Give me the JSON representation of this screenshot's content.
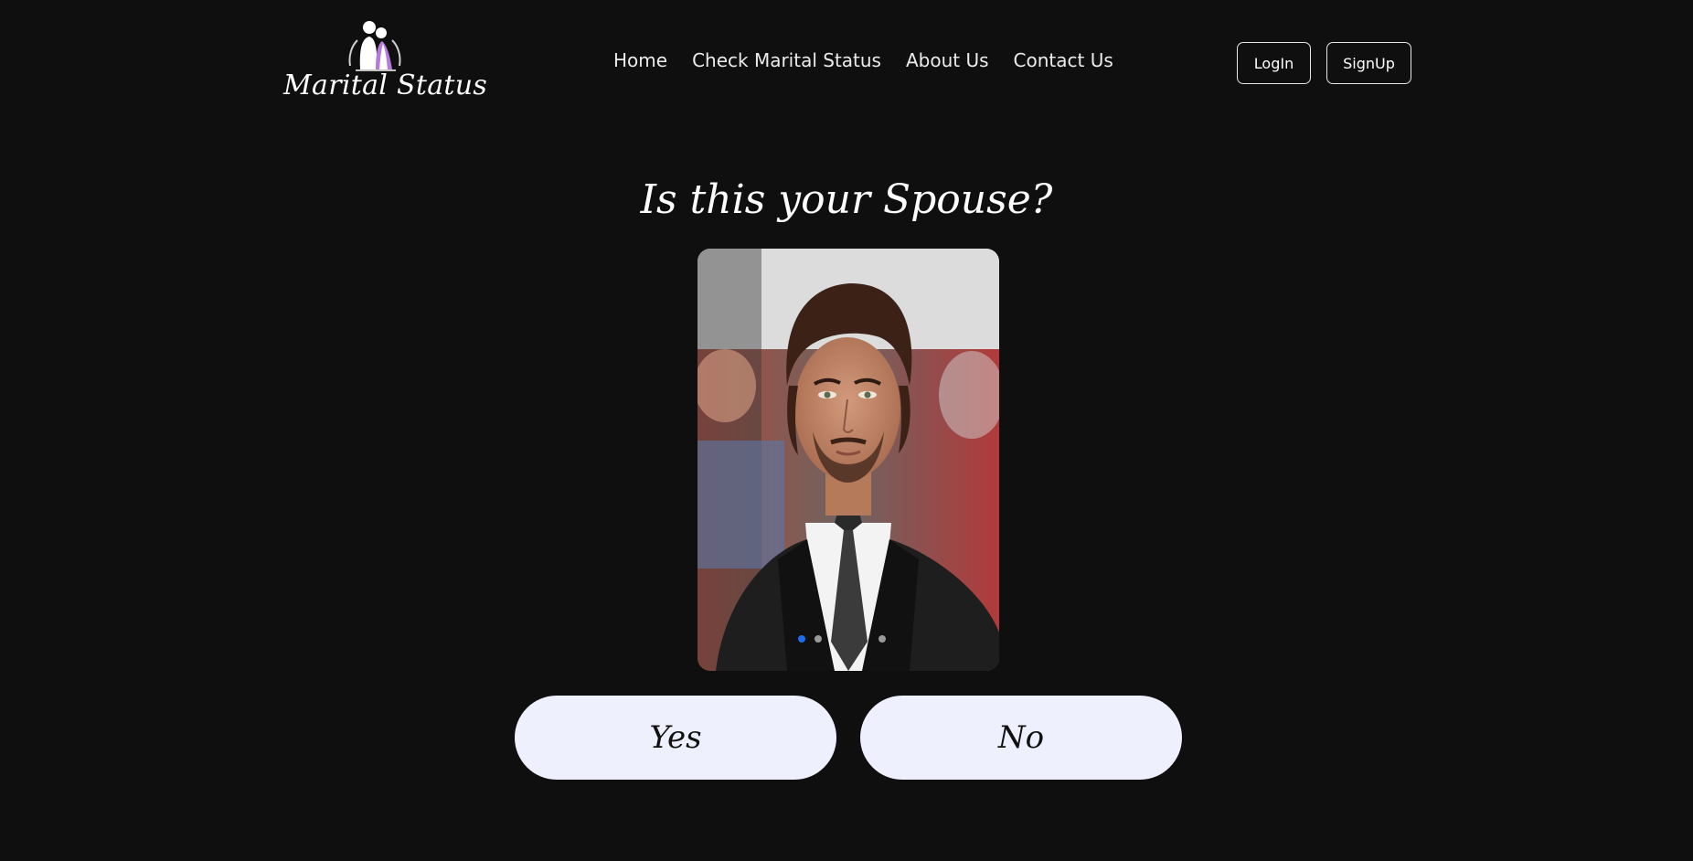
{
  "header": {
    "logo_text": "Marital Status",
    "nav": [
      "Home",
      "Check Marital Status",
      "About Us",
      "Contact Us"
    ],
    "login_label": "LogIn",
    "signup_label": "SignUp"
  },
  "main": {
    "question": "Is this your Spouse?",
    "carousel": {
      "slide_count": 4,
      "active_index": 0
    },
    "yes_label": "Yes",
    "no_label": "No"
  },
  "colors": {
    "background": "#0f0f0f",
    "button_fill": "#eef0fd",
    "active_dot": "#1d6cf0"
  }
}
